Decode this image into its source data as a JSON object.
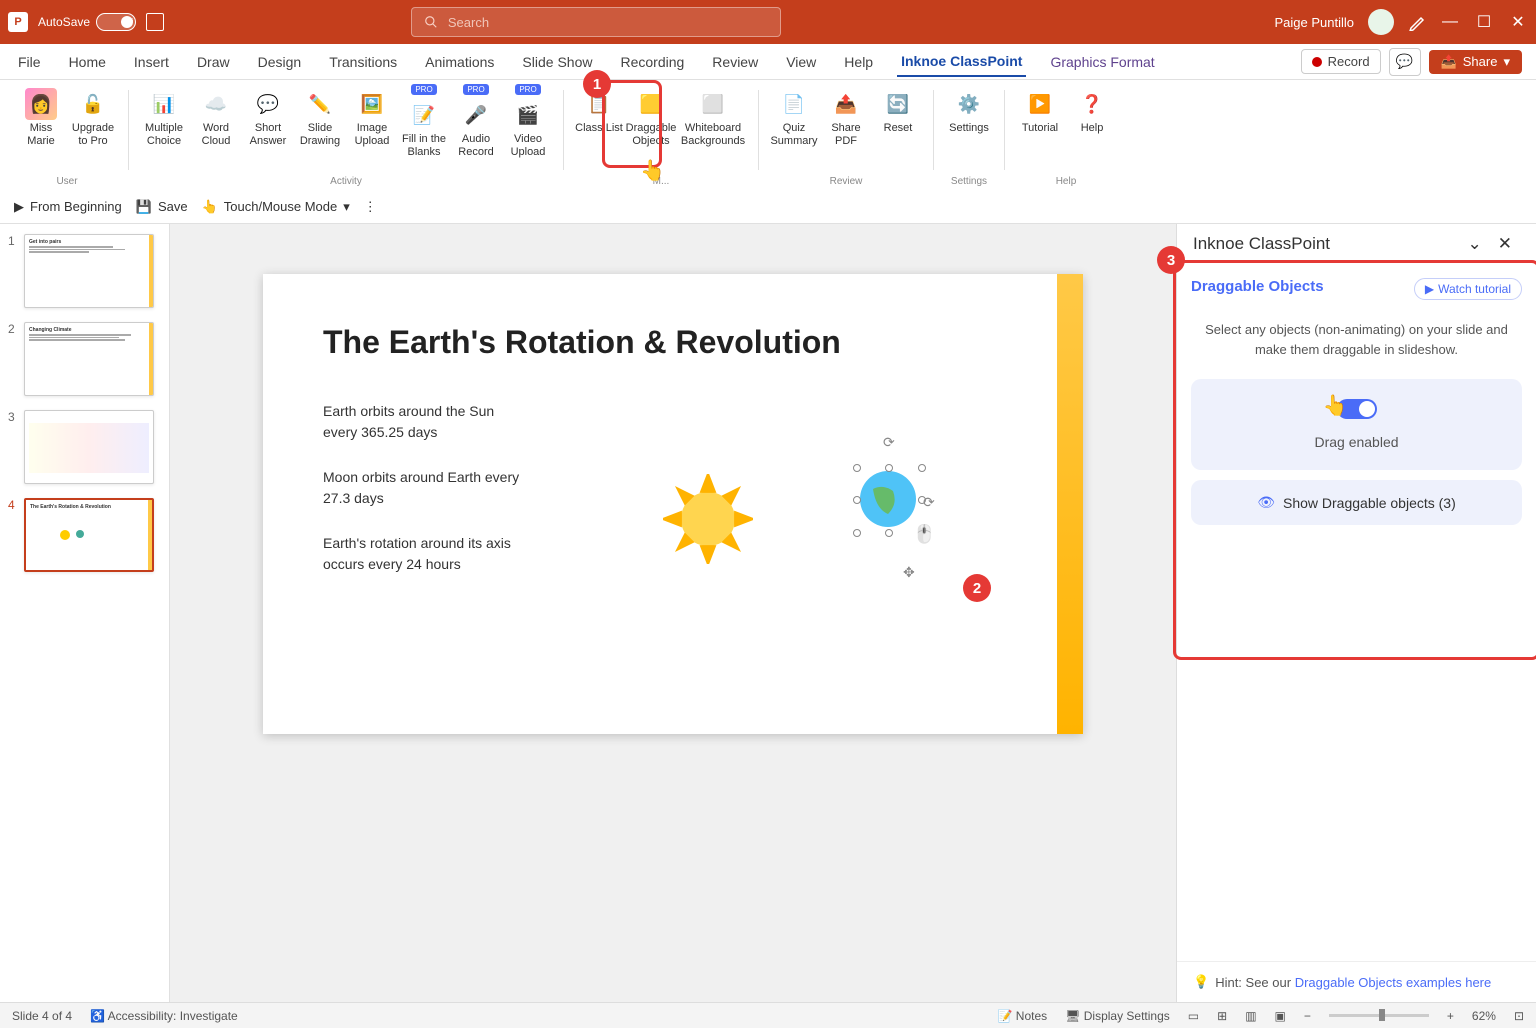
{
  "titlebar": {
    "autosave_label": "AutoSave",
    "autosave_state": "Off",
    "search_placeholder": "Search",
    "user_name": "Paige Puntillo"
  },
  "tabs": {
    "items": [
      "File",
      "Home",
      "Insert",
      "Draw",
      "Design",
      "Transitions",
      "Animations",
      "Slide Show",
      "Recording",
      "Review",
      "View",
      "Help",
      "Inknoe ClassPoint",
      "Graphics Format"
    ],
    "active_index": 12,
    "record_label": "Record",
    "share_label": "Share"
  },
  "ribbon": {
    "groups": [
      {
        "label": "User",
        "items": [
          {
            "label": "Miss Marie"
          },
          {
            "label": "Upgrade to Pro"
          }
        ]
      },
      {
        "label": "Activity",
        "items": [
          {
            "label": "Multiple Choice"
          },
          {
            "label": "Word Cloud"
          },
          {
            "label": "Short Answer"
          },
          {
            "label": "Slide Drawing"
          },
          {
            "label": "Image Upload"
          },
          {
            "label": "Fill in the Blanks",
            "pro": true
          },
          {
            "label": "Audio Record",
            "pro": true
          },
          {
            "label": "Video Upload",
            "pro": true
          }
        ]
      },
      {
        "label": "M...",
        "items": [
          {
            "label": "Class List"
          },
          {
            "label": "Draggable Objects"
          },
          {
            "label": "Whiteboard Backgrounds"
          }
        ]
      },
      {
        "label": "Review",
        "items": [
          {
            "label": "Quiz Summary"
          },
          {
            "label": "Share PDF"
          },
          {
            "label": "Reset"
          }
        ]
      },
      {
        "label": "Settings",
        "items": [
          {
            "label": "Settings"
          }
        ]
      },
      {
        "label": "Help",
        "items": [
          {
            "label": "Tutorial"
          },
          {
            "label": "Help"
          }
        ]
      }
    ]
  },
  "qat": {
    "from_beginning": "From Beginning",
    "save": "Save",
    "touch_mode": "Touch/Mouse Mode"
  },
  "thumbs": {
    "count": 4,
    "selected": 4,
    "titles": [
      "Get into pairs",
      "Changing Climate",
      "",
      "The Earth's Rotation & Revolution"
    ]
  },
  "slide": {
    "title": "The Earth's Rotation & Revolution",
    "para1": "Earth orbits around the Sun every 365.25 days",
    "para2": "Moon orbits around Earth every 27.3 days",
    "para3": "Earth's rotation around its axis occurs every 24 hours"
  },
  "sidepanel": {
    "title": "Inknoe ClassPoint",
    "section_title": "Draggable Objects",
    "watch": "Watch tutorial",
    "desc": "Select any objects (non-animating) on your slide and make them draggable in slideshow.",
    "toggle_label": "Drag enabled",
    "show_label": "Show Draggable objects (3)",
    "hint_prefix": "Hint: See our ",
    "hint_link": "Draggable Objects examples here"
  },
  "statusbar": {
    "slide_info": "Slide 4 of 4",
    "accessibility": "Accessibility: Investigate",
    "notes": "Notes",
    "display": "Display Settings",
    "zoom": "62%"
  },
  "annotations": {
    "badge1": "1",
    "badge2": "2",
    "badge3": "3"
  }
}
